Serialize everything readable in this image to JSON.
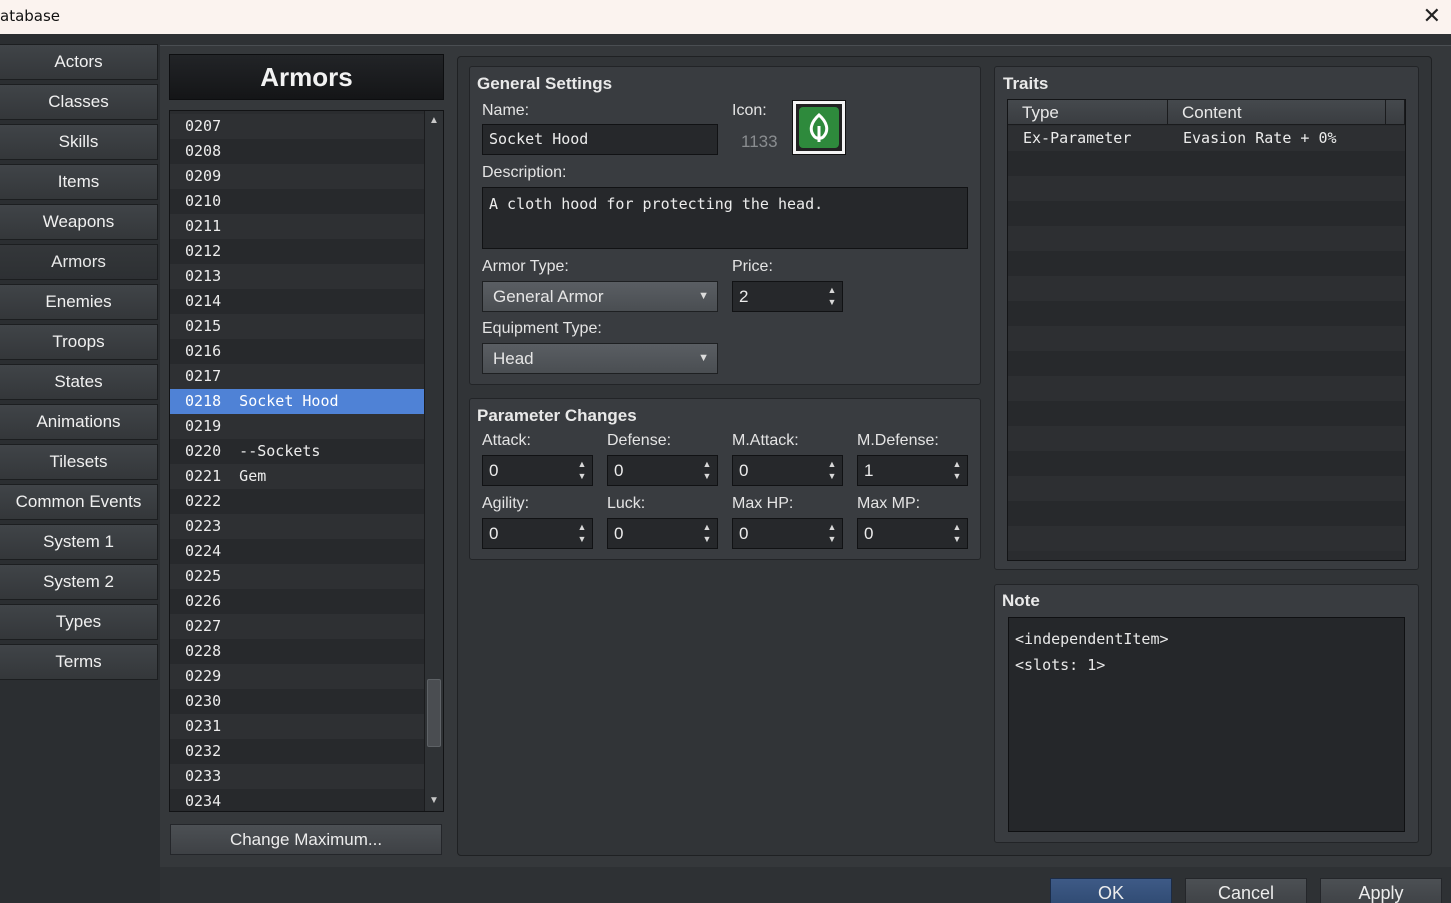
{
  "window": {
    "title": "atabase",
    "close_glyph": "✕"
  },
  "categories": [
    {
      "label": "Actors"
    },
    {
      "label": "Classes"
    },
    {
      "label": "Skills"
    },
    {
      "label": "Items"
    },
    {
      "label": "Weapons"
    },
    {
      "label": "Armors"
    },
    {
      "label": "Enemies"
    },
    {
      "label": "Troops"
    },
    {
      "label": "States"
    },
    {
      "label": "Animations"
    },
    {
      "label": "Tilesets"
    },
    {
      "label": "Common Events"
    },
    {
      "label": "System 1"
    },
    {
      "label": "System 2"
    },
    {
      "label": "Types"
    },
    {
      "label": "Terms"
    }
  ],
  "active_category": "Armors",
  "list": {
    "header": "Armors",
    "rows": [
      "0207",
      "0208",
      "0209",
      "0210",
      "0211",
      "0212",
      "0213",
      "0214",
      "0215",
      "0216",
      "0217",
      "0218  Socket Hood",
      "0219",
      "0220  --Sockets",
      "0221  Gem",
      "0222",
      "0223",
      "0224",
      "0225",
      "0226",
      "0227",
      "0228",
      "0229",
      "0230",
      "0231",
      "0232",
      "0233",
      "0234"
    ],
    "selected_row": "0218  Socket Hood",
    "change_max_label": "Change Maximum..."
  },
  "general": {
    "title": "General Settings",
    "name_label": "Name:",
    "name_value": "Socket Hood",
    "icon_label": "Icon:",
    "icon_index": "1133",
    "icon_name": "leaf-gem-icon",
    "description_label": "Description:",
    "description_value": "A cloth hood for protecting the head.",
    "armor_type_label": "Armor Type:",
    "armor_type_value": "General Armor",
    "price_label": "Price:",
    "price_value": "2",
    "equip_type_label": "Equipment Type:",
    "equip_type_value": "Head"
  },
  "params": {
    "title": "Parameter Changes",
    "items": [
      {
        "label": "Attack:",
        "value": "0"
      },
      {
        "label": "Defense:",
        "value": "0"
      },
      {
        "label": "M.Attack:",
        "value": "0"
      },
      {
        "label": "M.Defense:",
        "value": "1"
      },
      {
        "label": "Agility:",
        "value": "0"
      },
      {
        "label": "Luck:",
        "value": "0"
      },
      {
        "label": "Max HP:",
        "value": "0"
      },
      {
        "label": "Max MP:",
        "value": "0"
      }
    ]
  },
  "traits": {
    "title": "Traits",
    "col_type": "Type",
    "col_content": "Content",
    "rows": [
      {
        "type": "Ex-Parameter",
        "content": "Evasion Rate + 0%"
      }
    ]
  },
  "note": {
    "title": "Note",
    "lines": [
      "<independentItem>",
      "<slots: 1>"
    ]
  },
  "buttons": {
    "ok": "OK",
    "cancel": "Cancel",
    "apply": "Apply"
  },
  "colors": {
    "selection": "#4f82d6",
    "ok_button": "#3e5a86",
    "icon_green": "#2e8a3c"
  }
}
